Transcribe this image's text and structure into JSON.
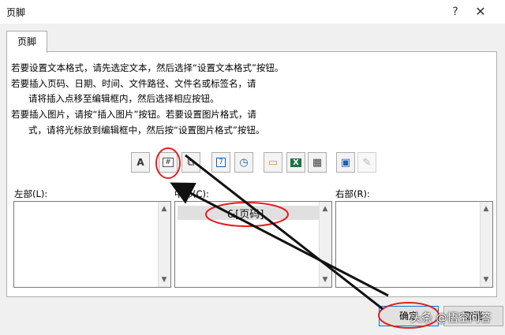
{
  "dialog": {
    "title": "页脚",
    "help_glyph": "?",
    "close_glyph": "✕",
    "tab_label": "页脚"
  },
  "instructions": [
    "若要设置文本格式，请先选定文本，然后选择“设置文本格式”按钮。",
    "若要插入页码、日期、时间、文件路径、文件名或标签名，请",
    "请将插入点移至编辑框内，然后选择相应按钮。",
    "若要插入图片，请按“插入图片”按钮。若要设置图片格式，请",
    "式，请将光标放到编辑框中，然后按“设置图片格式”按钮。"
  ],
  "toolbar": {
    "buttons": [
      {
        "icon": "format-text-icon",
        "glyph": "A"
      },
      {
        "icon": "page-number-icon",
        "glyph": "#"
      },
      {
        "icon": "page-count-icon",
        "glyph": "⧉"
      },
      {
        "icon": "date-icon",
        "glyph": "7"
      },
      {
        "icon": "time-icon",
        "glyph": "◷"
      },
      {
        "icon": "file-path-icon",
        "glyph": "▭"
      },
      {
        "icon": "file-name-icon",
        "glyph": "X"
      },
      {
        "icon": "sheet-name-icon",
        "glyph": "▦"
      },
      {
        "icon": "insert-picture-icon",
        "glyph": "▣"
      },
      {
        "icon": "format-picture-icon",
        "glyph": "✎"
      }
    ]
  },
  "sections": {
    "left_label": "左部(L):",
    "center_label": "中部(C):",
    "right_label": "右部(R):",
    "center_content": "&[页码]"
  },
  "buttons": {
    "ok": "确定",
    "cancel": "取消"
  },
  "watermark": "头条 @悟空问答",
  "annotation_color": "#e02020"
}
